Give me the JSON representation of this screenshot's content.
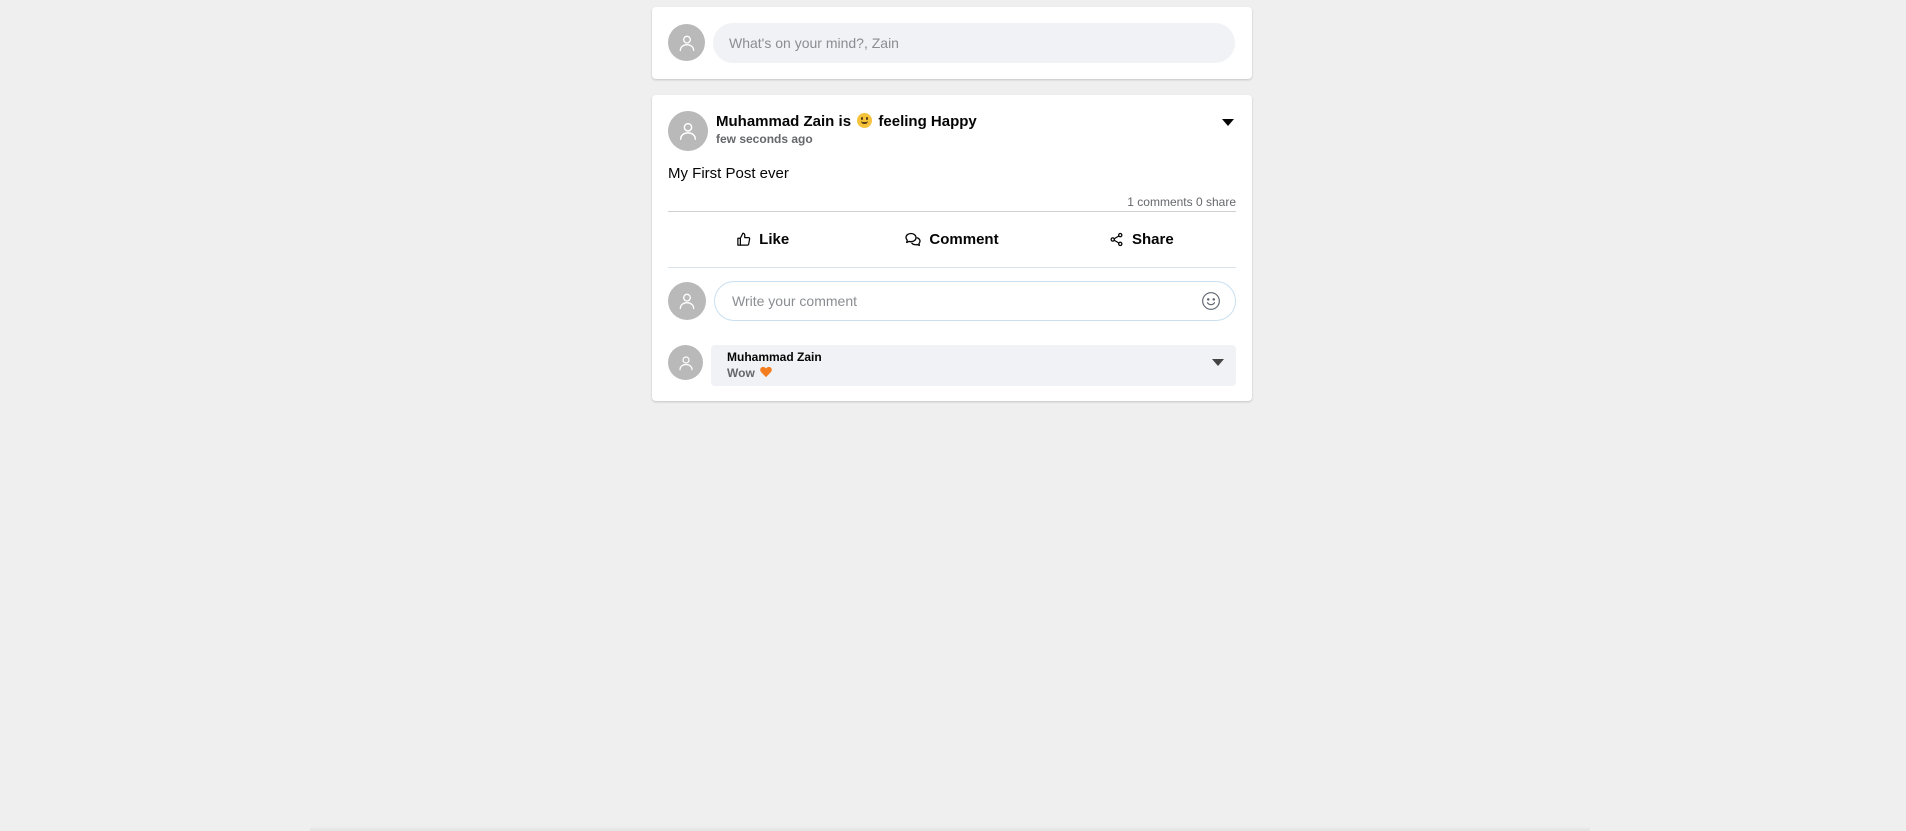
{
  "composer": {
    "avatar_icon": "user-icon",
    "placeholder": "What's on your mind?, Zain"
  },
  "post": {
    "author": "Muhammad Zain",
    "feeling_prefix": "is",
    "feeling_emoji": "grinning-face",
    "feeling_text": "feeling Happy",
    "timestamp": "few seconds ago",
    "body": "My First Post ever",
    "stats": "1 comments 0 share",
    "options_icon": "caret-down-icon",
    "actions": [
      {
        "label": "Like",
        "icon": "thumbs-up-icon"
      },
      {
        "label": "Comment",
        "icon": "chat-bubbles-icon"
      },
      {
        "label": "Share",
        "icon": "share-icon"
      }
    ],
    "comment_input": {
      "placeholder": "Write your comment",
      "emoji_icon": "smiley-icon"
    },
    "comments": [
      {
        "author": "Muhammad Zain",
        "text": "Wow",
        "emoji": "orange-heart"
      }
    ]
  }
}
